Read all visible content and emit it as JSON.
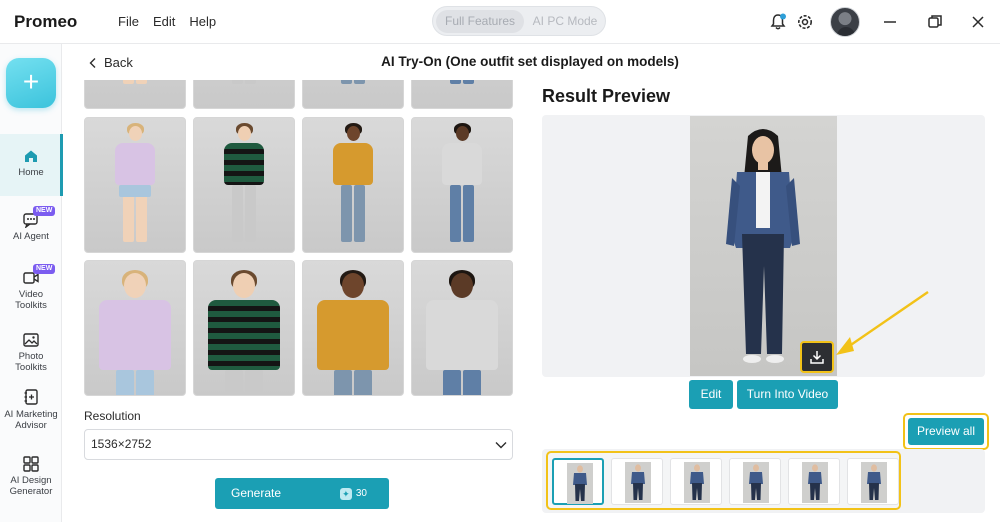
{
  "app": {
    "brand": "Promeo",
    "menu": [
      "File",
      "Edit",
      "Help"
    ],
    "mode_toggle": {
      "active": "Full Features",
      "inactive": "AI PC Mode"
    }
  },
  "sidebar": {
    "new_button": "+",
    "items": [
      {
        "label": "Home",
        "icon": "home-icon",
        "active": true
      },
      {
        "label": "AI Agent",
        "icon": "ai-agent-icon",
        "badge": "NEW"
      },
      {
        "label": "Video Toolkits",
        "icon": "video-icon",
        "badge": "NEW"
      },
      {
        "label": "Photo Toolkits",
        "icon": "photo-icon"
      },
      {
        "label": "AI Marketing Advisor",
        "icon": "marketing-icon"
      },
      {
        "label": "AI Design Generator",
        "icon": "design-grid-icon"
      }
    ]
  },
  "header": {
    "back_label": "Back",
    "title": "AI Try-On (One outfit set displayed on models)"
  },
  "gallery": {
    "models": [
      {
        "top": "#d8c3e4",
        "bottom": "#a9c6dd",
        "skin": "#f0d2b8",
        "hair": "#d8b37a"
      },
      {
        "top": "#1f5a3f",
        "bottom": "#c9c9c9",
        "skin": "#efcfb3",
        "hair": "#6a4a2f"
      },
      {
        "top": "#d69a2e",
        "bottom": "#7d95ad",
        "skin": "#6e452c",
        "hair": "#231a14"
      },
      {
        "top": "#d9d9d9",
        "bottom": "#5f7fa6",
        "skin": "#5b3a26",
        "hair": "#1d1611"
      }
    ]
  },
  "resolution": {
    "label": "Resolution",
    "value": "1536×2752"
  },
  "generate": {
    "label": "Generate",
    "cost": "30"
  },
  "result": {
    "title": "Result Preview",
    "edit_label": "Edit",
    "turn_into_video_label": "Turn Into Video",
    "preview_all_label": "Preview all",
    "thumbnail_count": 6,
    "selected_index": 0
  },
  "colors": {
    "accent": "#1b9fb4",
    "highlight": "#f2c218"
  }
}
